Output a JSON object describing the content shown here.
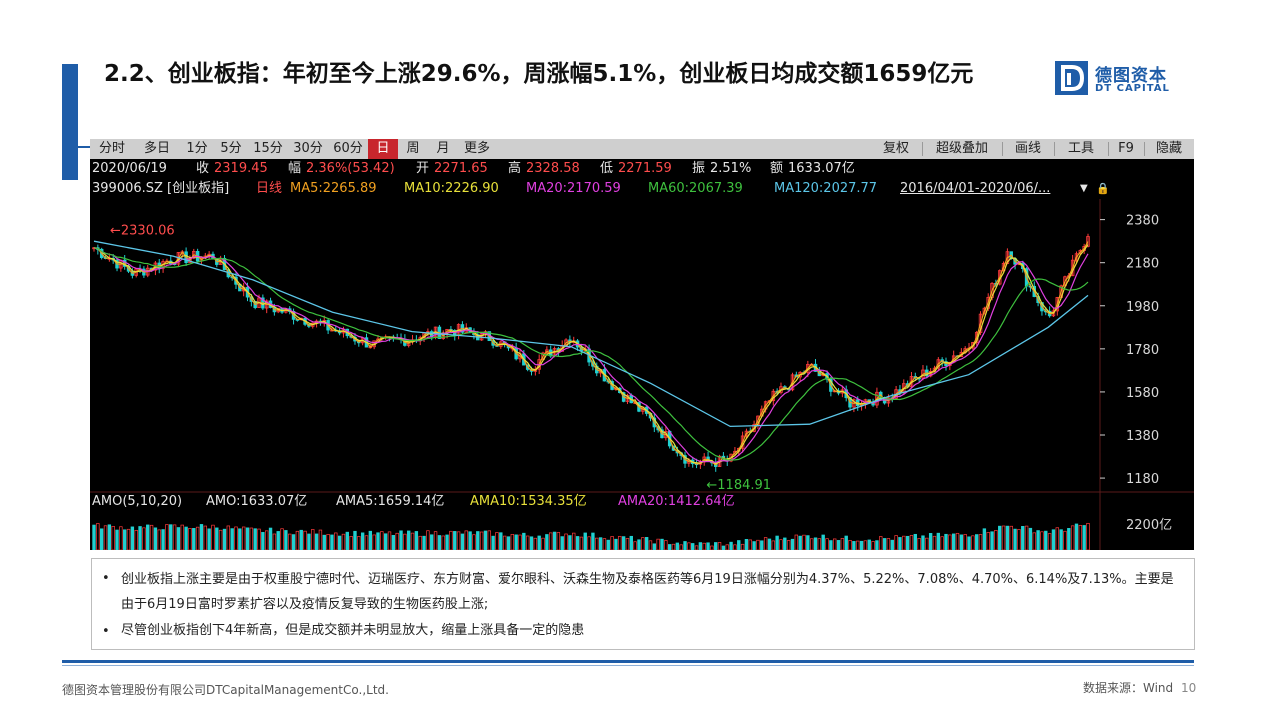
{
  "slide": {
    "title": "2.2、创业板指：年初至今上涨29.6%，周涨幅5.1%，创业板日均成交额1659亿元",
    "logo_cn": "德图资本",
    "logo_en": "DT CAPITAL",
    "accent_color": "#1f5da8"
  },
  "toolbar": {
    "left": [
      "分时",
      "多日",
      "1分",
      "5分",
      "15分",
      "30分",
      "60分",
      "日",
      "周",
      "月",
      "更多"
    ],
    "active": "日",
    "right": [
      "复权",
      "超级叠加",
      "画线",
      "工具",
      "F9",
      "隐藏"
    ]
  },
  "info1": {
    "date": "2020/06/19",
    "close_label": "收",
    "close": "2319.45",
    "chg_label": "幅",
    "chg": "2.36%(53.42)",
    "open_label": "开",
    "open": "2271.65",
    "high_label": "高",
    "high": "2328.58",
    "low_label": "低",
    "low": "2271.59",
    "amp_label": "振",
    "amp": "2.51%",
    "amt_label": "额",
    "amt": "1633.07亿"
  },
  "info2": {
    "code": "399006.SZ [创业板指]",
    "period": "日线",
    "ma5": "MA5:2265.89",
    "ma10": "MA10:2226.90",
    "ma20": "MA20:2170.59",
    "ma60": "MA60:2067.39",
    "ma120": "MA120:2027.77",
    "range": "2016/04/01-2020/06/..."
  },
  "chart_data": {
    "type": "line",
    "title": "399006.SZ [创业板指]",
    "x_range": [
      "2016/04/01",
      "2020/06/19"
    ],
    "y_ticks": [
      2380,
      2180,
      1980,
      1780,
      1580,
      1380,
      1180
    ],
    "ylim": [
      1120,
      2420
    ],
    "annotations": [
      {
        "text": "2330.06",
        "x": "2016/04",
        "y": 2330.06
      },
      {
        "text": "1184.91",
        "x": "2018/10",
        "y": 1184.91
      }
    ],
    "series": [
      {
        "name": "收",
        "x": [
          "2016/04",
          "2016/06",
          "2016/08",
          "2016/10",
          "2016/12",
          "2017/02",
          "2017/04",
          "2017/06",
          "2017/08",
          "2017/10",
          "2017/12",
          "2018/02",
          "2018/04",
          "2018/06",
          "2018/08",
          "2018/10",
          "2018/12",
          "2019/02",
          "2019/04",
          "2019/06",
          "2019/08",
          "2019/10",
          "2019/12",
          "2020/02",
          "2020/04",
          "2020/06"
        ],
        "values": [
          2250,
          2130,
          2200,
          2210,
          2000,
          1940,
          1870,
          1800,
          1830,
          1870,
          1830,
          1700,
          1840,
          1620,
          1450,
          1250,
          1260,
          1540,
          1700,
          1530,
          1560,
          1680,
          1790,
          2250,
          1920,
          2319
        ]
      },
      {
        "name": "MA120",
        "x": [
          "2016/04",
          "2016/08",
          "2016/12",
          "2017/04",
          "2017/08",
          "2017/12",
          "2018/04",
          "2018/08",
          "2018/12",
          "2019/04",
          "2019/08",
          "2019/12",
          "2020/04",
          "2020/06"
        ],
        "values": [
          2280,
          2210,
          2100,
          1950,
          1860,
          1830,
          1790,
          1620,
          1420,
          1430,
          1560,
          1660,
          1880,
          2028
        ]
      }
    ],
    "volume": {
      "label": "AMO(5,10,20)",
      "amo": "AMO:1633.07亿",
      "ama5": "AMA5:1659.14亿",
      "ama10": "AMA10:1534.35亿",
      "ama20": "AMA20:1412.64亿",
      "top_tick": "2200亿"
    }
  },
  "notes": {
    "items": [
      "创业板指上涨主要是由于权重股宁德时代、迈瑞医疗、东方财富、爱尔眼科、沃森生物及泰格医药等6月19日涨幅分别为4.37%、5.22%、7.08%、4.70%、6.14%及7.13%。主要是由于6月19日富时罗素扩容以及疫情反复导致的生物医药股上涨;",
      "尽管创业板指创下4年新高，但是成交额并未明显放大，缩量上涨具备一定的隐患"
    ]
  },
  "footer": {
    "company": "德图资本管理股份有限公司DTCapitalManagementCo.,Ltd.",
    "source": "数据来源：Wind",
    "page": "10"
  }
}
